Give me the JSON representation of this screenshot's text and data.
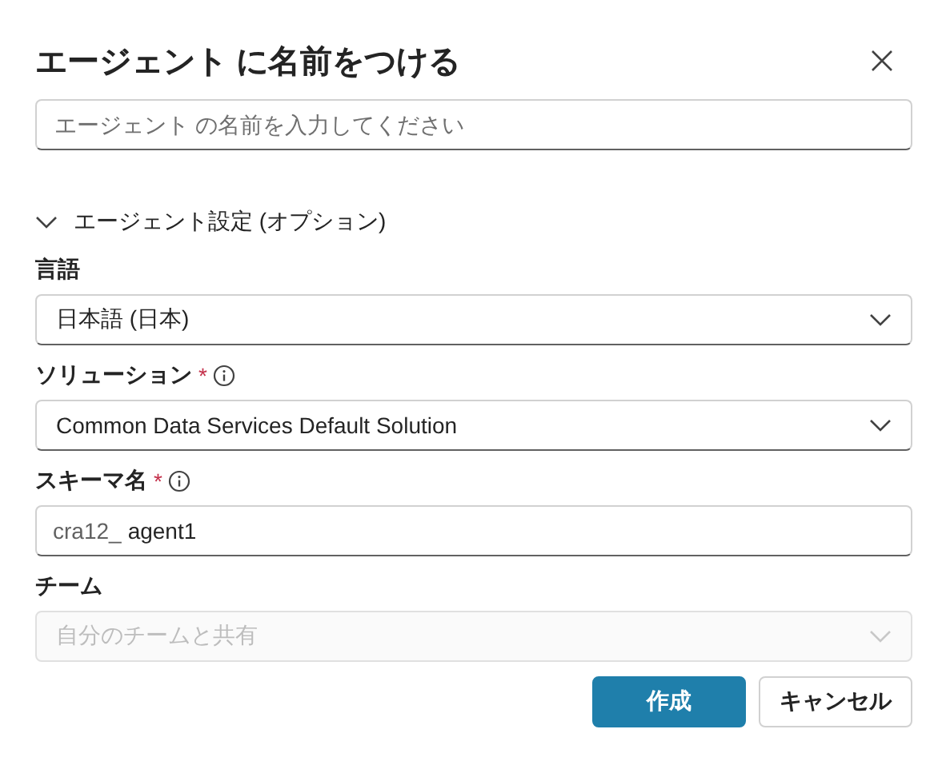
{
  "dialog": {
    "title": "エージェント に名前をつける",
    "name_field": {
      "placeholder": "エージェント の名前を入力してください"
    },
    "section": {
      "label": "エージェント設定 (オプション)",
      "expanded": true
    },
    "fields": [
      {
        "kind": "dropdown",
        "label": "言語",
        "info": false,
        "value": "日本語 (日本)",
        "disabled": false
      },
      {
        "kind": "dropdown",
        "label": "ソリューション",
        "required_mark": "*",
        "info": true,
        "value": "Common Data Services Default Solution",
        "disabled": false
      },
      {
        "kind": "text",
        "label": "スキーマ名",
        "required_mark": "*",
        "info": true,
        "prefix": "cra12_",
        "value": "agent1"
      },
      {
        "kind": "dropdown",
        "label": "チーム",
        "info": false,
        "placeholder": "自分のチームと共有",
        "disabled": true
      }
    ],
    "buttons": [
      {
        "label": "作成",
        "primary": true
      },
      {
        "label": "キャンセル",
        "primary": false
      }
    ]
  }
}
